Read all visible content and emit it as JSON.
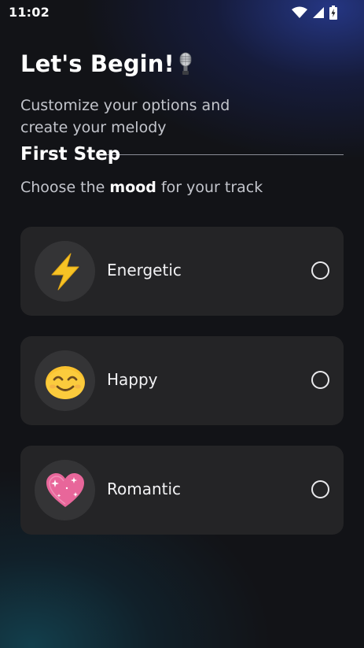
{
  "status_bar": {
    "time": "11:02",
    "icons": [
      "wifi-icon",
      "cellular-signal-icon",
      "battery-charging-icon"
    ]
  },
  "header": {
    "title": "Let's Begin!",
    "title_icon": "microphone-icon",
    "subtitle": "Customize your options and create your melody"
  },
  "step": {
    "title": "First Step",
    "prompt_prefix": "Choose the ",
    "prompt_bold": "mood",
    "prompt_suffix": " for your track"
  },
  "moods": [
    {
      "label": "Energetic",
      "icon": "lightning-bolt-icon",
      "selected": false
    },
    {
      "label": "Happy",
      "icon": "smiling-face-icon",
      "selected": false
    },
    {
      "label": "Romantic",
      "icon": "sparkling-heart-icon",
      "selected": false
    }
  ],
  "colors": {
    "card_background": "#242426",
    "icon_circle": "#343436",
    "lightning": "#f7c325",
    "smile": "#f9c12e",
    "heart": "#e8669a"
  }
}
